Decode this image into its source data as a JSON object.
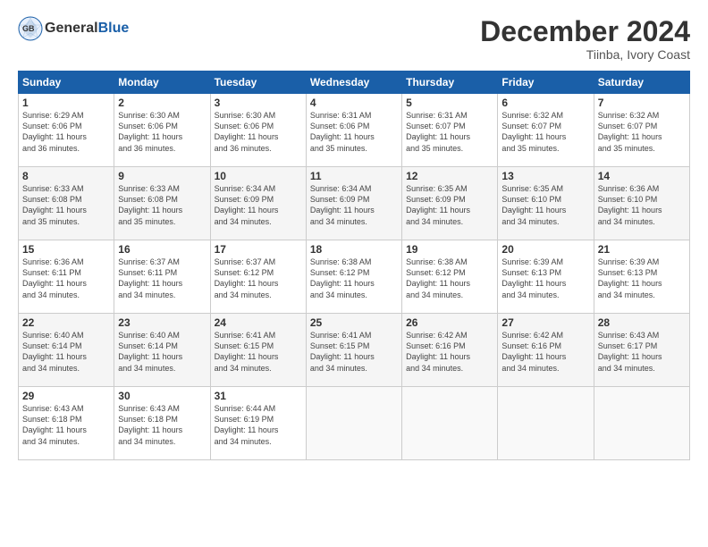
{
  "header": {
    "logo_general": "General",
    "logo_blue": "Blue",
    "month_title": "December 2024",
    "subtitle": "Tiinba, Ivory Coast"
  },
  "days_of_week": [
    "Sunday",
    "Monday",
    "Tuesday",
    "Wednesday",
    "Thursday",
    "Friday",
    "Saturday"
  ],
  "weeks": [
    [
      {
        "day": "1",
        "detail": "Sunrise: 6:29 AM\nSunset: 6:06 PM\nDaylight: 11 hours\nand 36 minutes."
      },
      {
        "day": "2",
        "detail": "Sunrise: 6:30 AM\nSunset: 6:06 PM\nDaylight: 11 hours\nand 36 minutes."
      },
      {
        "day": "3",
        "detail": "Sunrise: 6:30 AM\nSunset: 6:06 PM\nDaylight: 11 hours\nand 36 minutes."
      },
      {
        "day": "4",
        "detail": "Sunrise: 6:31 AM\nSunset: 6:06 PM\nDaylight: 11 hours\nand 35 minutes."
      },
      {
        "day": "5",
        "detail": "Sunrise: 6:31 AM\nSunset: 6:07 PM\nDaylight: 11 hours\nand 35 minutes."
      },
      {
        "day": "6",
        "detail": "Sunrise: 6:32 AM\nSunset: 6:07 PM\nDaylight: 11 hours\nand 35 minutes."
      },
      {
        "day": "7",
        "detail": "Sunrise: 6:32 AM\nSunset: 6:07 PM\nDaylight: 11 hours\nand 35 minutes."
      }
    ],
    [
      {
        "day": "8",
        "detail": "Sunrise: 6:33 AM\nSunset: 6:08 PM\nDaylight: 11 hours\nand 35 minutes."
      },
      {
        "day": "9",
        "detail": "Sunrise: 6:33 AM\nSunset: 6:08 PM\nDaylight: 11 hours\nand 35 minutes."
      },
      {
        "day": "10",
        "detail": "Sunrise: 6:34 AM\nSunset: 6:09 PM\nDaylight: 11 hours\nand 34 minutes."
      },
      {
        "day": "11",
        "detail": "Sunrise: 6:34 AM\nSunset: 6:09 PM\nDaylight: 11 hours\nand 34 minutes."
      },
      {
        "day": "12",
        "detail": "Sunrise: 6:35 AM\nSunset: 6:09 PM\nDaylight: 11 hours\nand 34 minutes."
      },
      {
        "day": "13",
        "detail": "Sunrise: 6:35 AM\nSunset: 6:10 PM\nDaylight: 11 hours\nand 34 minutes."
      },
      {
        "day": "14",
        "detail": "Sunrise: 6:36 AM\nSunset: 6:10 PM\nDaylight: 11 hours\nand 34 minutes."
      }
    ],
    [
      {
        "day": "15",
        "detail": "Sunrise: 6:36 AM\nSunset: 6:11 PM\nDaylight: 11 hours\nand 34 minutes."
      },
      {
        "day": "16",
        "detail": "Sunrise: 6:37 AM\nSunset: 6:11 PM\nDaylight: 11 hours\nand 34 minutes."
      },
      {
        "day": "17",
        "detail": "Sunrise: 6:37 AM\nSunset: 6:12 PM\nDaylight: 11 hours\nand 34 minutes."
      },
      {
        "day": "18",
        "detail": "Sunrise: 6:38 AM\nSunset: 6:12 PM\nDaylight: 11 hours\nand 34 minutes."
      },
      {
        "day": "19",
        "detail": "Sunrise: 6:38 AM\nSunset: 6:12 PM\nDaylight: 11 hours\nand 34 minutes."
      },
      {
        "day": "20",
        "detail": "Sunrise: 6:39 AM\nSunset: 6:13 PM\nDaylight: 11 hours\nand 34 minutes."
      },
      {
        "day": "21",
        "detail": "Sunrise: 6:39 AM\nSunset: 6:13 PM\nDaylight: 11 hours\nand 34 minutes."
      }
    ],
    [
      {
        "day": "22",
        "detail": "Sunrise: 6:40 AM\nSunset: 6:14 PM\nDaylight: 11 hours\nand 34 minutes."
      },
      {
        "day": "23",
        "detail": "Sunrise: 6:40 AM\nSunset: 6:14 PM\nDaylight: 11 hours\nand 34 minutes."
      },
      {
        "day": "24",
        "detail": "Sunrise: 6:41 AM\nSunset: 6:15 PM\nDaylight: 11 hours\nand 34 minutes."
      },
      {
        "day": "25",
        "detail": "Sunrise: 6:41 AM\nSunset: 6:15 PM\nDaylight: 11 hours\nand 34 minutes."
      },
      {
        "day": "26",
        "detail": "Sunrise: 6:42 AM\nSunset: 6:16 PM\nDaylight: 11 hours\nand 34 minutes."
      },
      {
        "day": "27",
        "detail": "Sunrise: 6:42 AM\nSunset: 6:16 PM\nDaylight: 11 hours\nand 34 minutes."
      },
      {
        "day": "28",
        "detail": "Sunrise: 6:43 AM\nSunset: 6:17 PM\nDaylight: 11 hours\nand 34 minutes."
      }
    ],
    [
      {
        "day": "29",
        "detail": "Sunrise: 6:43 AM\nSunset: 6:18 PM\nDaylight: 11 hours\nand 34 minutes."
      },
      {
        "day": "30",
        "detail": "Sunrise: 6:43 AM\nSunset: 6:18 PM\nDaylight: 11 hours\nand 34 minutes."
      },
      {
        "day": "31",
        "detail": "Sunrise: 6:44 AM\nSunset: 6:19 PM\nDaylight: 11 hours\nand 34 minutes."
      },
      {
        "day": "",
        "detail": ""
      },
      {
        "day": "",
        "detail": ""
      },
      {
        "day": "",
        "detail": ""
      },
      {
        "day": "",
        "detail": ""
      }
    ]
  ]
}
